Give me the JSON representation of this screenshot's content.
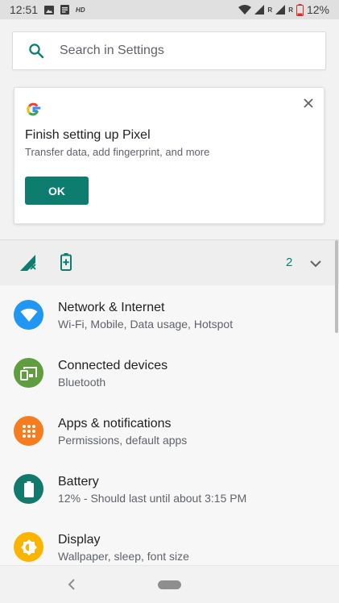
{
  "status_bar": {
    "time": "12:51",
    "hd_label": "HD",
    "roaming_1": "R",
    "roaming_2": "R",
    "battery_percent": "12%"
  },
  "search": {
    "placeholder": "Search in Settings"
  },
  "suggestion": {
    "title": "Finish setting up Pixel",
    "subtitle": "Transfer data, add fingerprint, and more",
    "ok_label": "OK"
  },
  "conditions": {
    "count": "2"
  },
  "settings": [
    {
      "title": "Network & Internet",
      "subtitle": "Wi-Fi, Mobile, Data usage, Hotspot",
      "icon": "wifi-icon",
      "color": "#2196f3"
    },
    {
      "title": "Connected devices",
      "subtitle": "Bluetooth",
      "icon": "devices-icon",
      "color": "#5e9e3c"
    },
    {
      "title": "Apps & notifications",
      "subtitle": "Permissions, default apps",
      "icon": "apps-icon",
      "color": "#f57c1f"
    },
    {
      "title": "Battery",
      "subtitle": "12% - Should last until about 3:15 PM",
      "icon": "battery-icon",
      "color": "#127a6c"
    },
    {
      "title": "Display",
      "subtitle": "Wallpaper, sleep, font size",
      "icon": "display-icon",
      "color": "#fbb400"
    }
  ],
  "colors": {
    "accent": "#0d7d70",
    "background": "#f2f2f2"
  }
}
